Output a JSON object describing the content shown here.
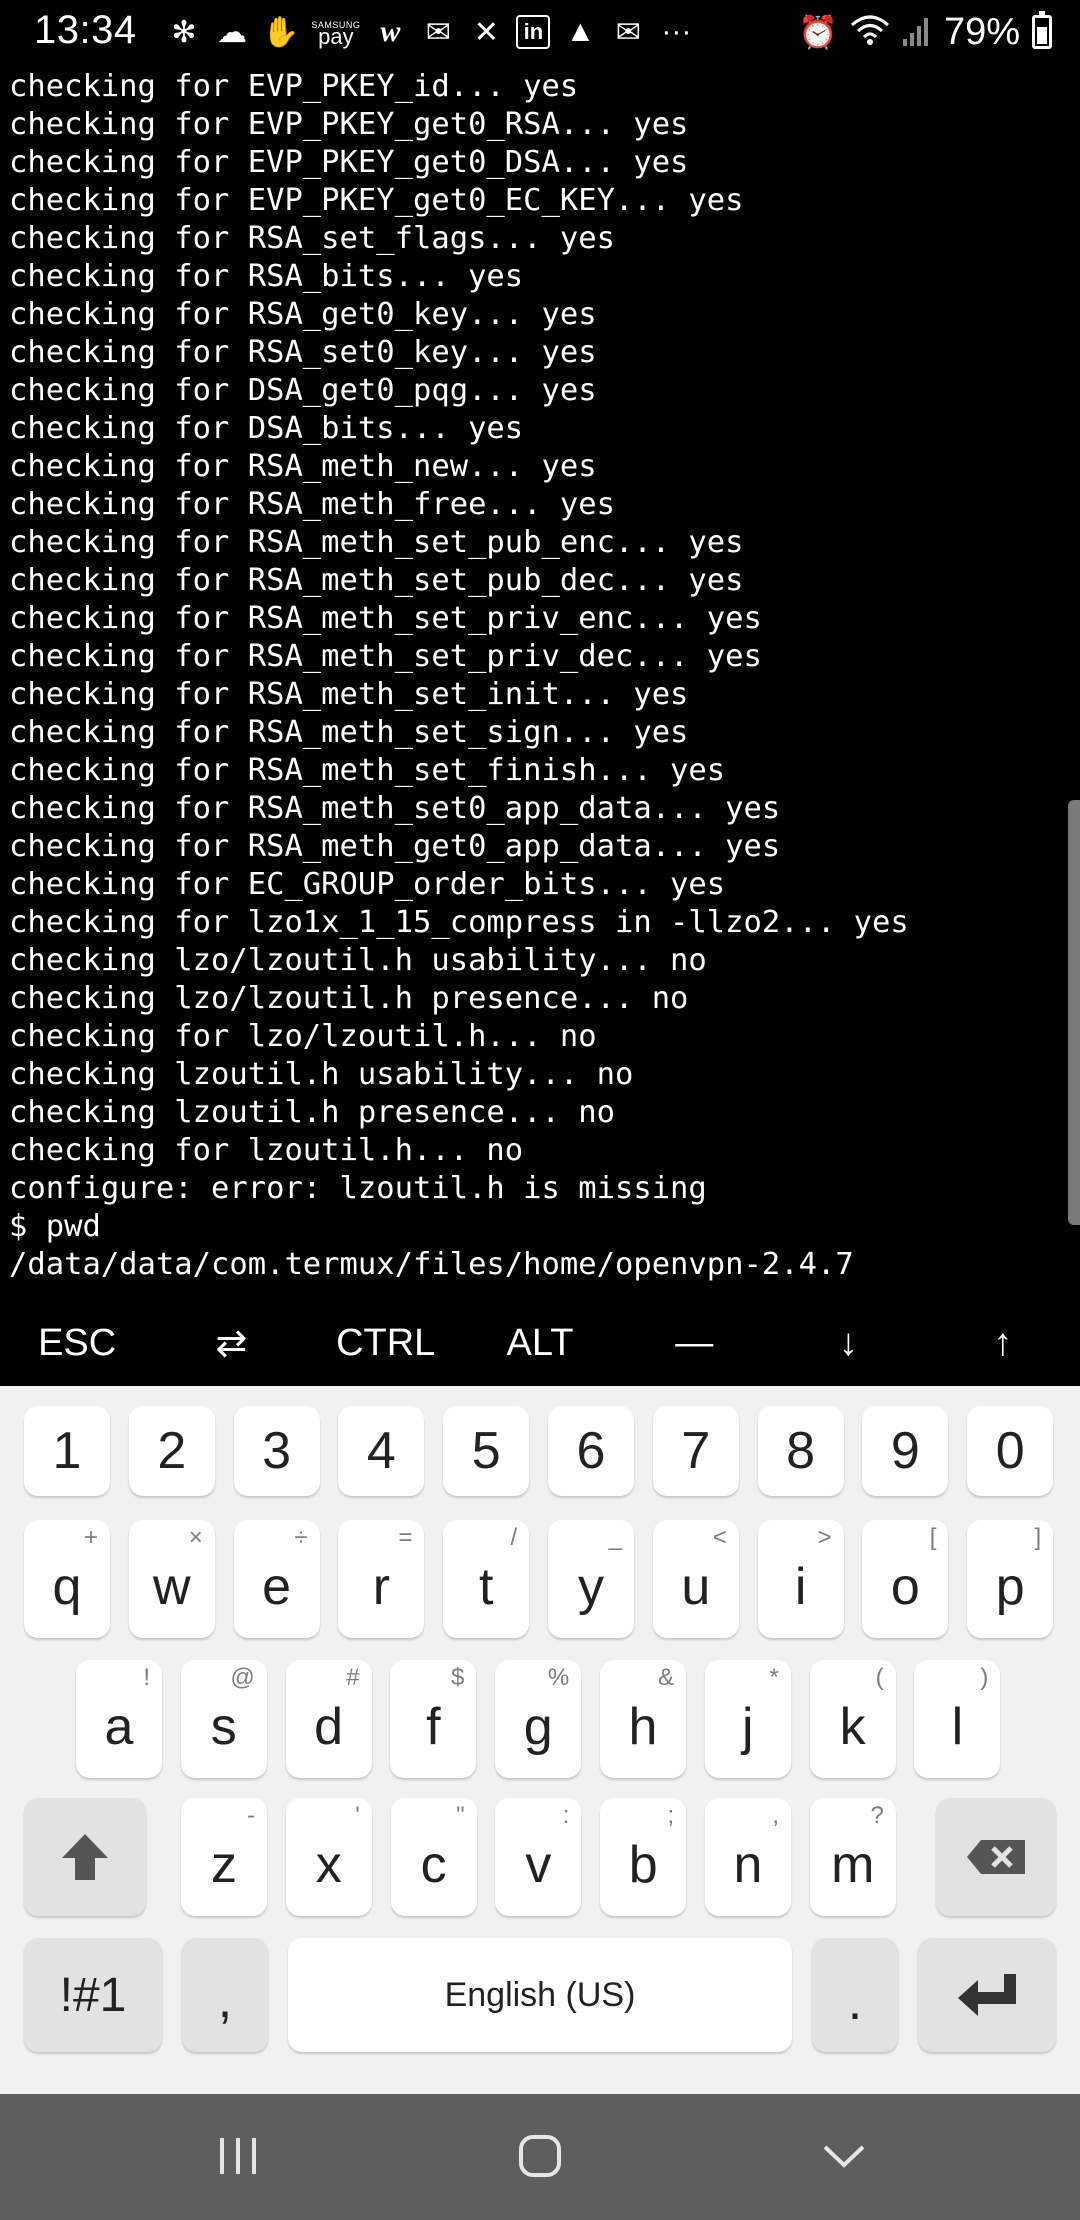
{
  "status_bar": {
    "time": "13:34",
    "pay_brand": "SAMSUNG",
    "pay_label": "pay",
    "more": "···",
    "battery_pct": "79%",
    "icons": [
      "slack-icon",
      "cloud-icon",
      "hand-icon",
      "samsung-pay-icon",
      "w-icon",
      "mail-icon",
      "close-icon",
      "linkedin-icon",
      "drive-icon",
      "mail-icon",
      "more-icon",
      "alarm-icon",
      "wifi-icon",
      "signal-icon",
      "battery-icon"
    ]
  },
  "terminal": {
    "lines": [
      "checking for EVP_PKEY_id... yes",
      "checking for EVP_PKEY_get0_RSA... yes",
      "checking for EVP_PKEY_get0_DSA... yes",
      "checking for EVP_PKEY_get0_EC_KEY... yes",
      "checking for RSA_set_flags... yes",
      "checking for RSA_bits... yes",
      "checking for RSA_get0_key... yes",
      "checking for RSA_set0_key... yes",
      "checking for DSA_get0_pqg... yes",
      "checking for DSA_bits... yes",
      "checking for RSA_meth_new... yes",
      "checking for RSA_meth_free... yes",
      "checking for RSA_meth_set_pub_enc... yes",
      "checking for RSA_meth_set_pub_dec... yes",
      "checking for RSA_meth_set_priv_enc... yes",
      "checking for RSA_meth_set_priv_dec... yes",
      "checking for RSA_meth_set_init... yes",
      "checking for RSA_meth_set_sign... yes",
      "checking for RSA_meth_set_finish... yes",
      "checking for RSA_meth_set0_app_data... yes",
      "checking for RSA_meth_get0_app_data... yes",
      "checking for EC_GROUP_order_bits... yes",
      "checking for lzo1x_1_15_compress in -llzo2... yes",
      "checking lzo/lzoutil.h usability... no",
      "checking lzo/lzoutil.h presence... no",
      "checking for lzo/lzoutil.h... no",
      "checking lzoutil.h usability... no",
      "checking lzoutil.h presence... no",
      "checking for lzoutil.h... no",
      "configure: error: lzoutil.h is missing",
      "$ pwd",
      "/data/data/com.termux/files/home/openvpn-2.4.7"
    ]
  },
  "extra_keys": [
    "ESC",
    "⇄",
    "CTRL",
    "ALT",
    "—",
    "↓",
    "↑"
  ],
  "keyboard": {
    "numbers": [
      "1",
      "2",
      "3",
      "4",
      "5",
      "6",
      "7",
      "8",
      "9",
      "0"
    ],
    "row1": [
      {
        "k": "q",
        "s": "+"
      },
      {
        "k": "w",
        "s": "×"
      },
      {
        "k": "e",
        "s": "÷"
      },
      {
        "k": "r",
        "s": "="
      },
      {
        "k": "t",
        "s": "/"
      },
      {
        "k": "y",
        "s": "_"
      },
      {
        "k": "u",
        "s": "<"
      },
      {
        "k": "i",
        "s": ">"
      },
      {
        "k": "o",
        "s": "["
      },
      {
        "k": "p",
        "s": "]"
      }
    ],
    "row2": [
      {
        "k": "a",
        "s": "!"
      },
      {
        "k": "s",
        "s": "@"
      },
      {
        "k": "d",
        "s": "#"
      },
      {
        "k": "f",
        "s": "$"
      },
      {
        "k": "g",
        "s": "%"
      },
      {
        "k": "h",
        "s": "&"
      },
      {
        "k": "j",
        "s": "*"
      },
      {
        "k": "k",
        "s": "("
      },
      {
        "k": "l",
        "s": ")"
      }
    ],
    "row3": [
      {
        "k": "z",
        "s": "-"
      },
      {
        "k": "x",
        "s": "'"
      },
      {
        "k": "c",
        "s": "\""
      },
      {
        "k": "v",
        "s": ":"
      },
      {
        "k": "b",
        "s": ";"
      },
      {
        "k": "n",
        "s": ","
      },
      {
        "k": "m",
        "s": "?"
      }
    ],
    "symbols_label": "!#1",
    "comma_label": ",",
    "space_label": "English (US)",
    "period_label": "."
  },
  "nav": [
    "recent-apps-icon",
    "home-icon",
    "hide-keyboard-icon"
  ]
}
